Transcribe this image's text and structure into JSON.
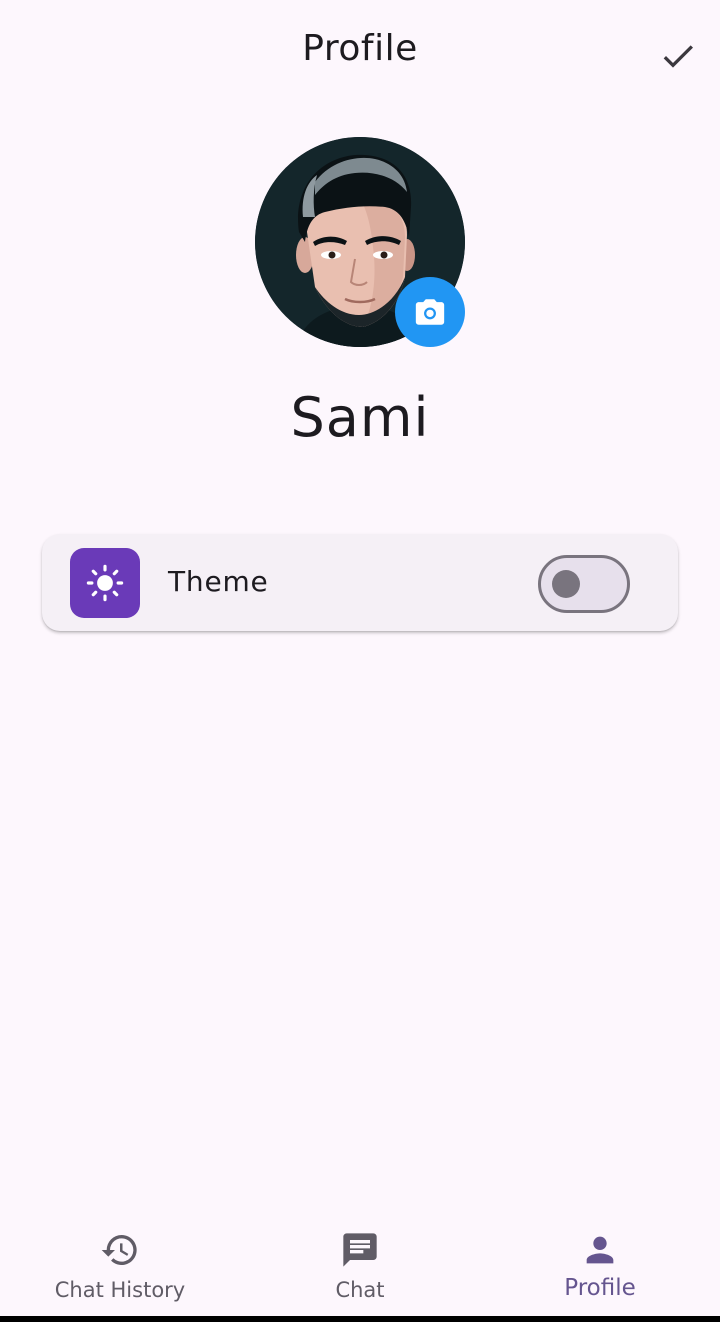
{
  "header": {
    "title": "Profile",
    "confirm_icon": "check-icon"
  },
  "profile": {
    "name": "Sami",
    "avatar_icon": "avatar-illustration",
    "camera_icon": "camera-icon",
    "camera_color": "#2196f3"
  },
  "settings": {
    "theme": {
      "label": "Theme",
      "icon": "sun-icon",
      "icon_bg": "#6a3ab8",
      "enabled": false
    }
  },
  "nav": {
    "items": [
      {
        "label": "Chat History",
        "icon": "history-icon",
        "active": false
      },
      {
        "label": "Chat",
        "icon": "chat-icon",
        "active": false
      },
      {
        "label": "Profile",
        "icon": "person-icon",
        "active": true
      }
    ],
    "active_color": "#65558f",
    "inactive_color": "#605c66"
  }
}
